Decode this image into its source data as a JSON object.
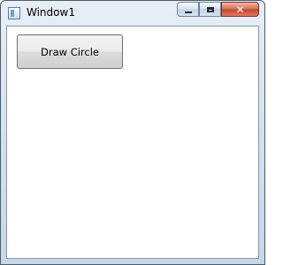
{
  "window": {
    "title": "Window1",
    "controls": {
      "minimize_icon": "minimize-icon",
      "maximize_icon": "maximize-icon",
      "close_label": "✕"
    },
    "accent": "#c6442d"
  },
  "content": {
    "draw_button_label": "Draw Circle"
  }
}
